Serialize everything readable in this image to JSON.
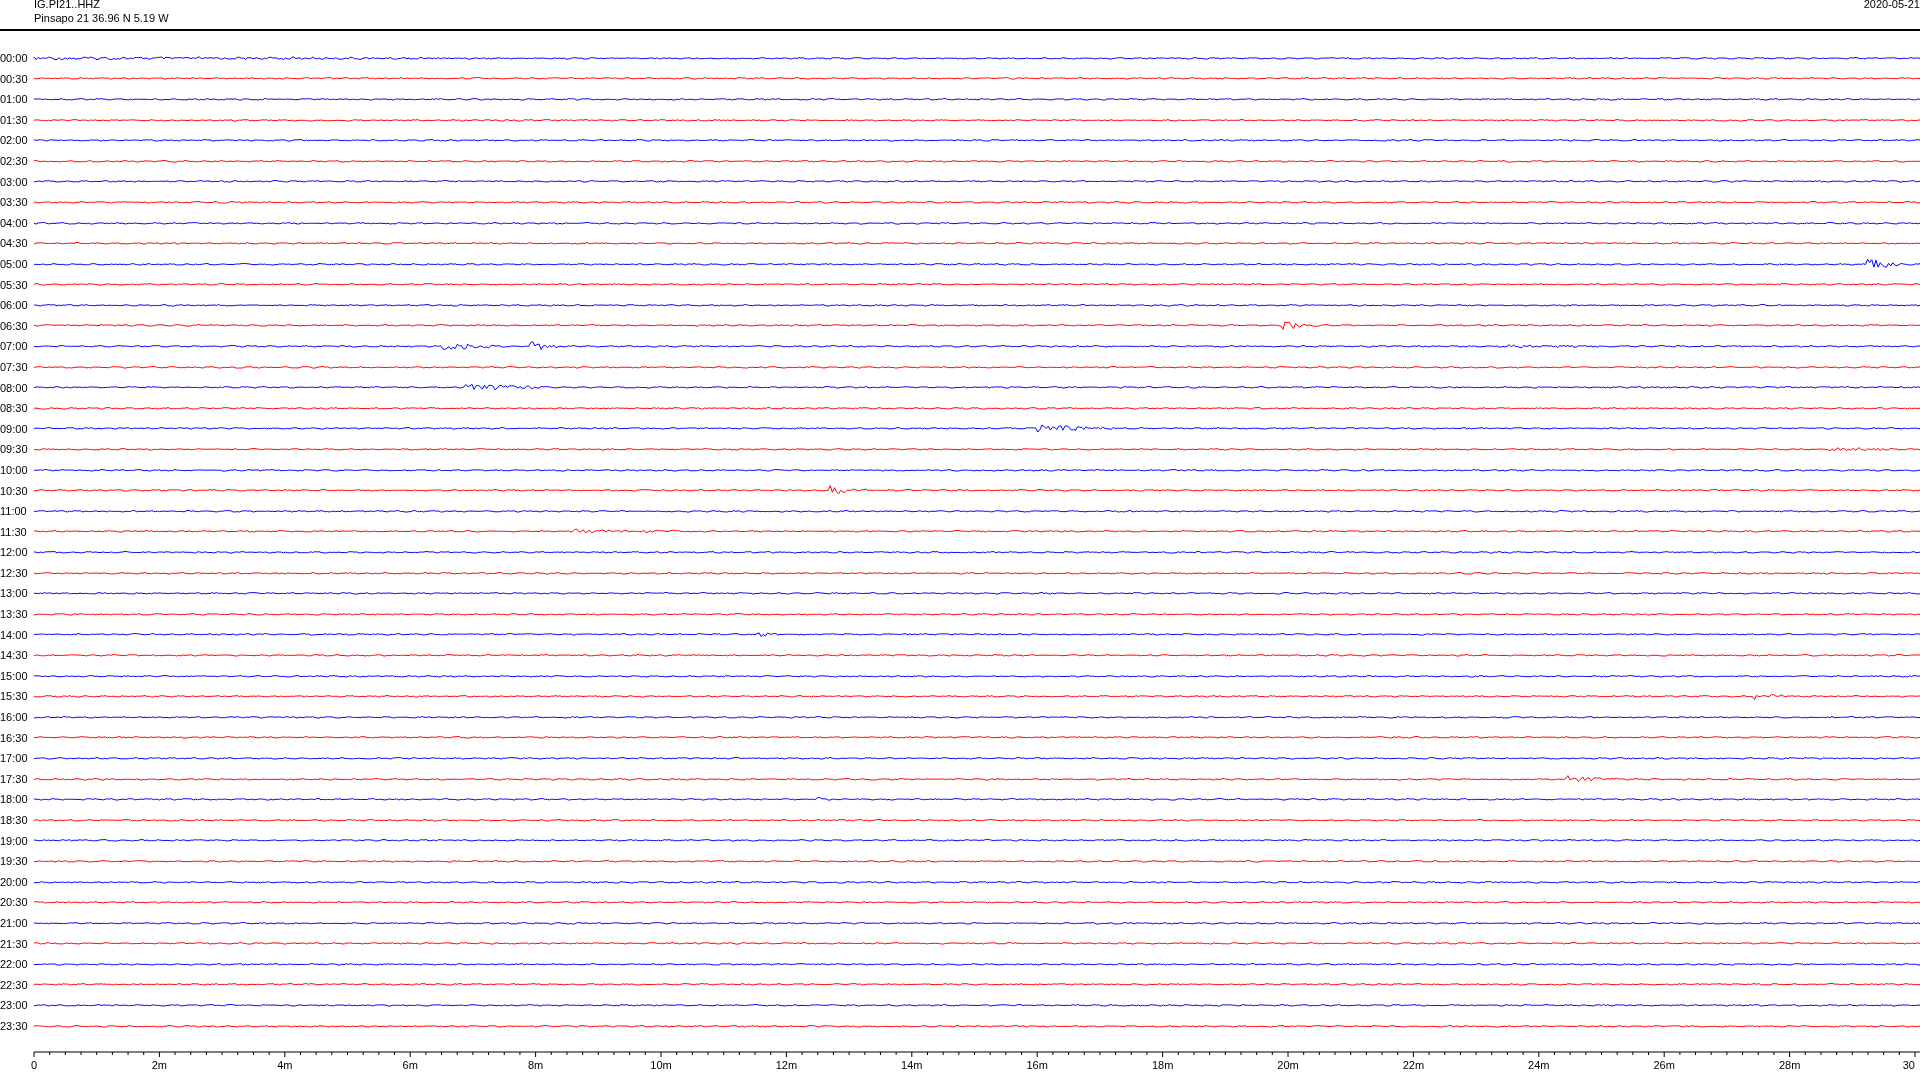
{
  "header": {
    "station": "IG.PI21..HHZ",
    "location": "Pinsapo 21  36.96 N 5.19 W",
    "date": "2020-05-21"
  },
  "rows": [
    {
      "label": "00:00",
      "color": "#0000ff"
    },
    {
      "label": "00:30",
      "color": "#ff0000"
    },
    {
      "label": "01:00",
      "color": "#0000ff"
    },
    {
      "label": "01:30",
      "color": "#ff0000"
    },
    {
      "label": "02:00",
      "color": "#0000ff"
    },
    {
      "label": "02:30",
      "color": "#ff0000"
    },
    {
      "label": "03:00",
      "color": "#0000ff"
    },
    {
      "label": "03:30",
      "color": "#ff0000"
    },
    {
      "label": "04:00",
      "color": "#0000ff"
    },
    {
      "label": "04:30",
      "color": "#ff0000"
    },
    {
      "label": "05:00",
      "color": "#0000ff"
    },
    {
      "label": "05:30",
      "color": "#ff0000"
    },
    {
      "label": "06:00",
      "color": "#0000ff"
    },
    {
      "label": "06:30",
      "color": "#ff0000"
    },
    {
      "label": "07:00",
      "color": "#0000ff"
    },
    {
      "label": "07:30",
      "color": "#ff0000"
    },
    {
      "label": "08:00",
      "color": "#0000ff"
    },
    {
      "label": "08:30",
      "color": "#ff0000"
    },
    {
      "label": "09:00",
      "color": "#0000ff"
    },
    {
      "label": "09:30",
      "color": "#ff0000"
    },
    {
      "label": "10:00",
      "color": "#0000ff"
    },
    {
      "label": "10:30",
      "color": "#ff0000"
    },
    {
      "label": "11:00",
      "color": "#0000ff"
    },
    {
      "label": "11:30",
      "color": "#ff0000"
    },
    {
      "label": "12:00",
      "color": "#0000ff"
    },
    {
      "label": "12:30",
      "color": "#ff0000"
    },
    {
      "label": "13:00",
      "color": "#0000ff"
    },
    {
      "label": "13:30",
      "color": "#ff0000"
    },
    {
      "label": "14:00",
      "color": "#0000ff"
    },
    {
      "label": "14:30",
      "color": "#ff0000"
    },
    {
      "label": "15:00",
      "color": "#0000ff"
    },
    {
      "label": "15:30",
      "color": "#ff0000"
    },
    {
      "label": "16:00",
      "color": "#0000ff"
    },
    {
      "label": "16:30",
      "color": "#ff0000"
    },
    {
      "label": "17:00",
      "color": "#0000ff"
    },
    {
      "label": "17:30",
      "color": "#ff0000"
    },
    {
      "label": "18:00",
      "color": "#0000ff"
    },
    {
      "label": "18:30",
      "color": "#ff0000"
    },
    {
      "label": "19:00",
      "color": "#0000ff"
    },
    {
      "label": "19:30",
      "color": "#ff0000"
    },
    {
      "label": "20:00",
      "color": "#0000ff"
    },
    {
      "label": "20:30",
      "color": "#ff0000"
    },
    {
      "label": "21:00",
      "color": "#0000ff"
    },
    {
      "label": "21:30",
      "color": "#ff0000"
    },
    {
      "label": "22:00",
      "color": "#0000ff"
    },
    {
      "label": "22:30",
      "color": "#ff0000"
    },
    {
      "label": "23:00",
      "color": "#0000ff"
    },
    {
      "label": "23:30",
      "color": "#ff0000"
    }
  ],
  "axis": {
    "ticks": [
      "0",
      "2m",
      "4m",
      "6m",
      "8m",
      "10m",
      "12m",
      "14m",
      "16m",
      "18m",
      "20m",
      "22m",
      "24m",
      "26m",
      "28m",
      "30"
    ]
  }
}
